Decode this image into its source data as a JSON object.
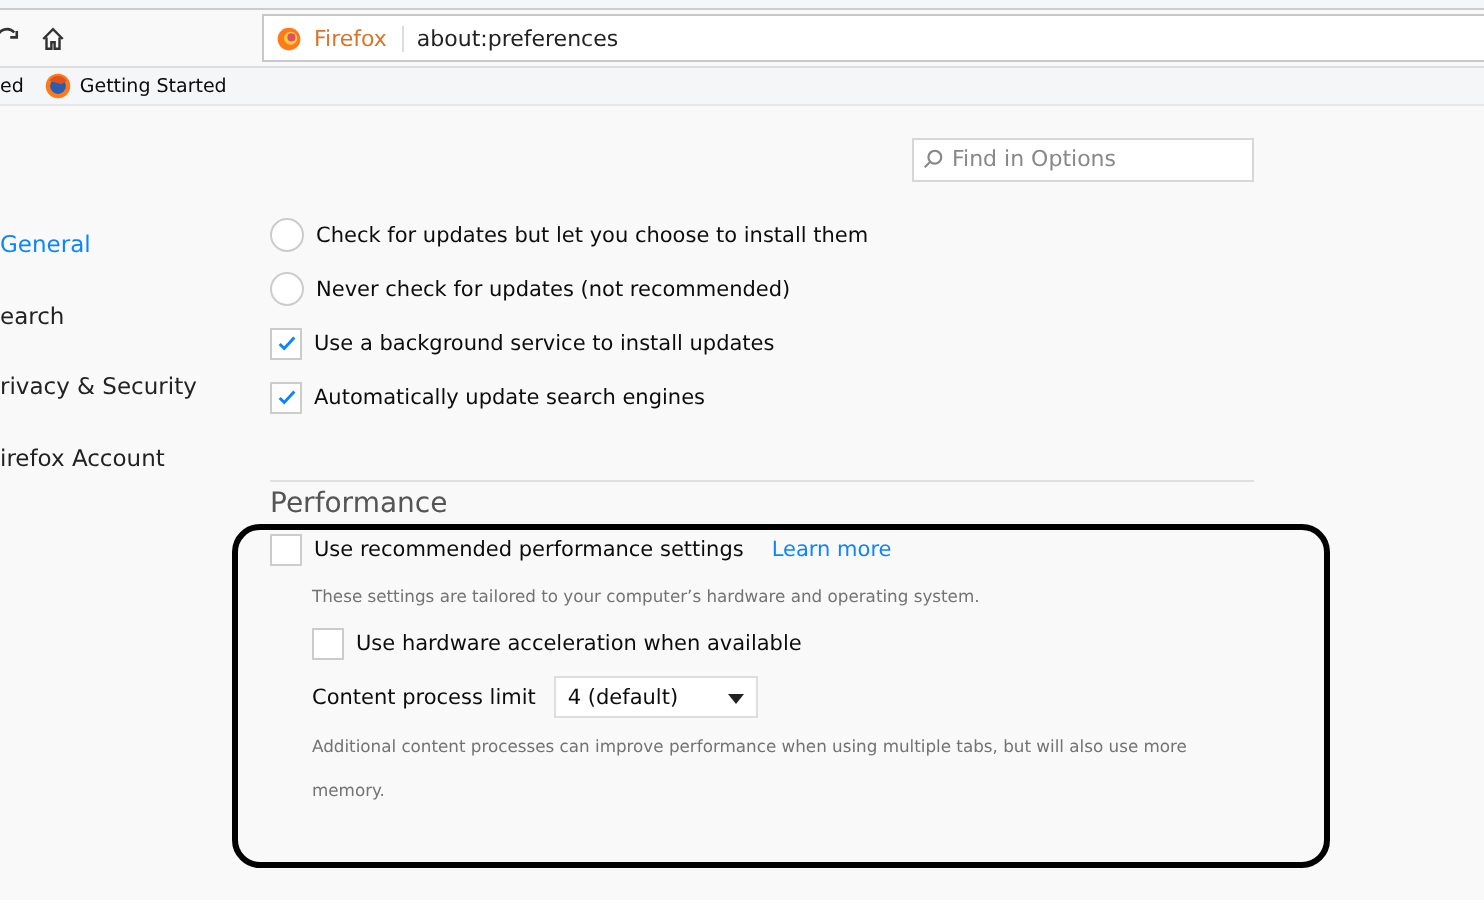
{
  "toolbar": {
    "identity": "Firefox",
    "url": "about:preferences"
  },
  "bookmarks": [
    {
      "label": "ed",
      "kind": "text"
    },
    {
      "label": "Getting Started",
      "kind": "firefox"
    }
  ],
  "search": {
    "placeholder": "Find in Options"
  },
  "sidebar": {
    "items": [
      {
        "label": "General",
        "selected": true
      },
      {
        "label": "earch",
        "selected": false
      },
      {
        "label": "rivacy & Security",
        "selected": false
      },
      {
        "label": "irefox Account",
        "selected": false
      }
    ]
  },
  "update_options": [
    {
      "kind": "radio",
      "label": "Check for updates but let you choose to install them",
      "checked": false
    },
    {
      "kind": "radio",
      "label": "Never check for updates (not recommended)",
      "checked": false
    },
    {
      "kind": "checkbox",
      "label": "Use a background service to install updates",
      "checked": true
    },
    {
      "kind": "checkbox",
      "label": "Automatically update search engines",
      "checked": true
    }
  ],
  "performance": {
    "heading": "Performance",
    "recommended": {
      "label": "Use recommended performance settings",
      "checked": false,
      "link": "Learn more"
    },
    "recommended_note": "These settings are tailored to your computer’s hardware and operating system.",
    "hardware": {
      "label": "Use hardware acceleration when available",
      "checked": false
    },
    "process_limit": {
      "label": "Content process limit",
      "value": "4 (default)"
    },
    "process_note": "Additional content processes can improve performance when using multiple tabs, but will also use more memory."
  }
}
